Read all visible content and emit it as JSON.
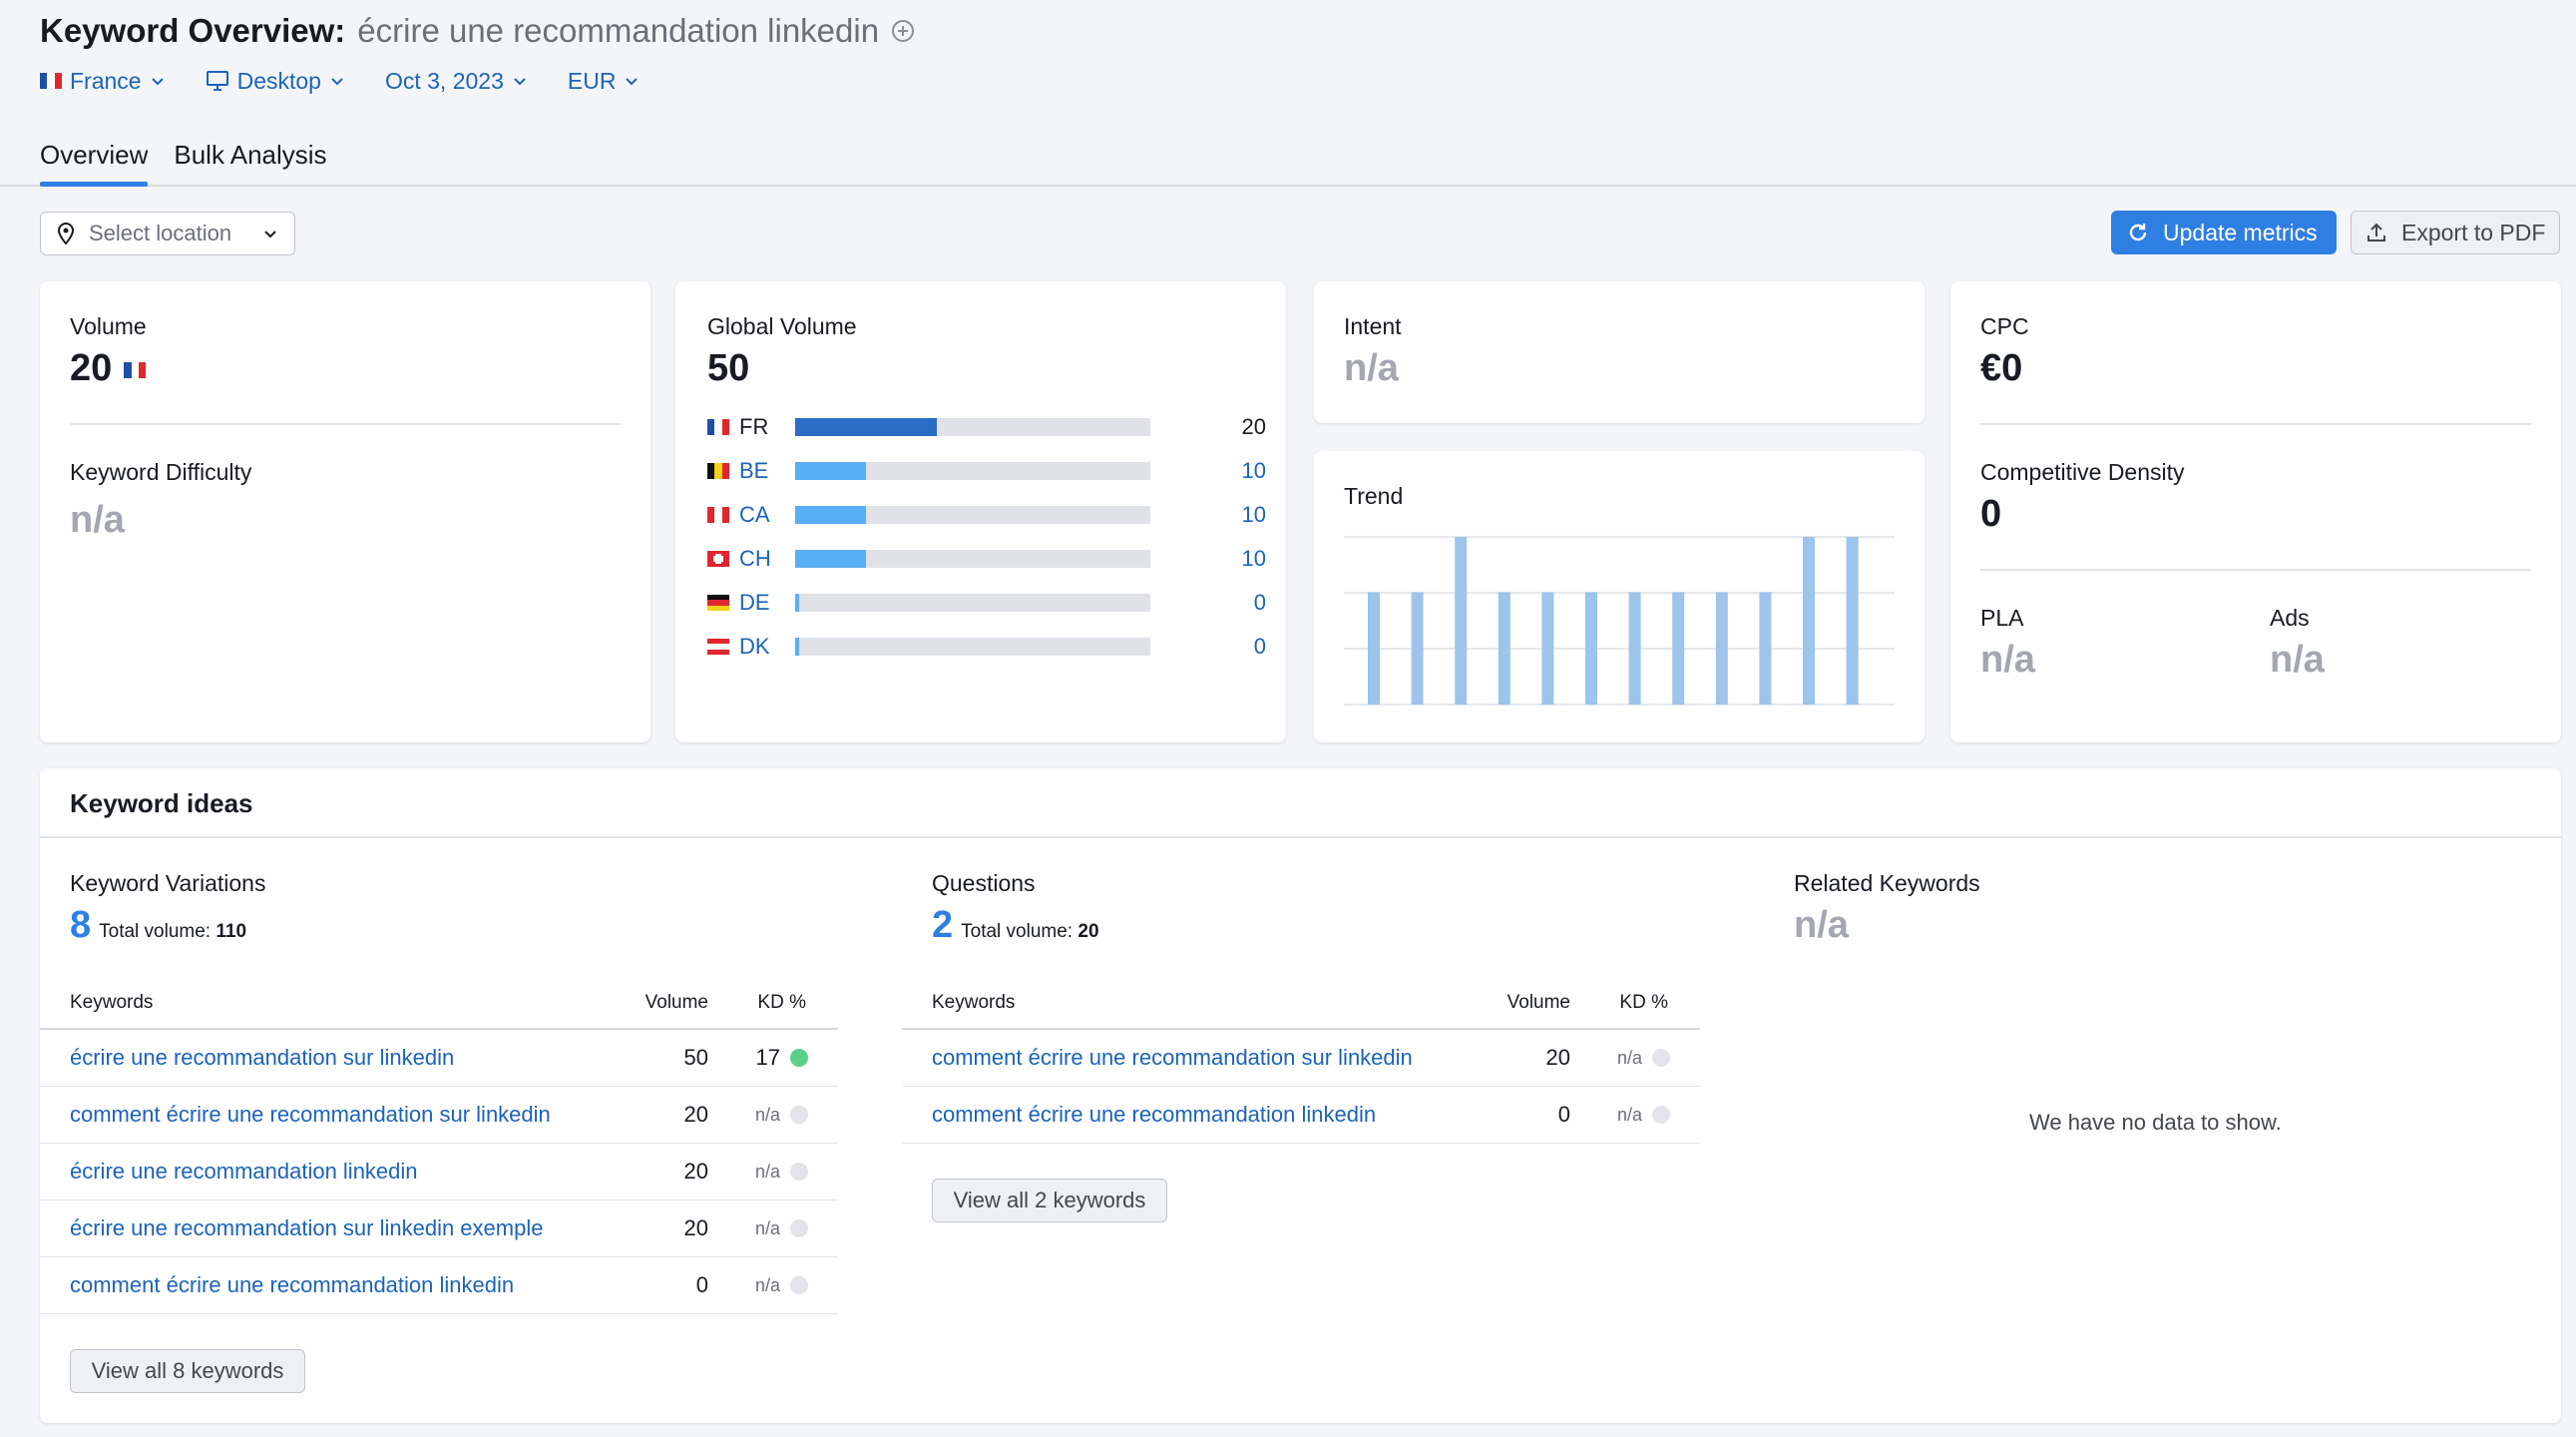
{
  "header": {
    "title": "Keyword Overview:",
    "keyword": "écrire une recommandation linkedin",
    "filters": {
      "country": "France",
      "device": "Desktop",
      "date": "Oct 3, 2023",
      "currency": "EUR"
    },
    "tabs": [
      "Overview",
      "Bulk Analysis"
    ]
  },
  "toolbar": {
    "location_placeholder": "Select location",
    "update_label": "Update metrics",
    "export_label": "Export to PDF"
  },
  "volume_card": {
    "volume_label": "Volume",
    "volume_value": "20",
    "kd_label": "Keyword Difficulty",
    "kd_value": "n/a"
  },
  "global_volume": {
    "label": "Global Volume",
    "value": "50",
    "max": 50,
    "countries": [
      {
        "code": "FR",
        "value": 20
      },
      {
        "code": "BE",
        "value": 10
      },
      {
        "code": "CA",
        "value": 10
      },
      {
        "code": "CH",
        "value": 10
      },
      {
        "code": "DE",
        "value": 0
      },
      {
        "code": "DK",
        "value": 0
      }
    ]
  },
  "intent": {
    "label": "Intent",
    "value": "n/a"
  },
  "trend": {
    "label": "Trend",
    "values": [
      0.67,
      0.67,
      1.0,
      0.67,
      0.67,
      0.67,
      0.67,
      0.67,
      0.67,
      0.67,
      1.0,
      1.0
    ]
  },
  "cpc_card": {
    "cpc_label": "CPC",
    "cpc_value": "€0",
    "cd_label": "Competitive Density",
    "cd_value": "0",
    "pla_label": "PLA",
    "pla_value": "n/a",
    "ads_label": "Ads",
    "ads_value": "n/a"
  },
  "keyword_ideas": {
    "title": "Keyword ideas",
    "variations": {
      "title": "Keyword Variations",
      "count": "8",
      "total_label": "Total volume:",
      "total_value": "110",
      "col_keywords": "Keywords",
      "col_volume": "Volume",
      "col_kd": "KD %",
      "rows": [
        {
          "keyword": "écrire une recommandation sur linkedin",
          "volume": "50",
          "kd": "17",
          "kd_color": "#5bd08a"
        },
        {
          "keyword": "comment écrire une recommandation sur linkedin",
          "volume": "20",
          "kd": "n/a",
          "kd_color": "#e2e4ea"
        },
        {
          "keyword": "écrire une recommandation linkedin",
          "volume": "20",
          "kd": "n/a",
          "kd_color": "#e2e4ea"
        },
        {
          "keyword": "écrire une recommandation sur linkedin exemple",
          "volume": "20",
          "kd": "n/a",
          "kd_color": "#e2e4ea"
        },
        {
          "keyword": "comment écrire une recommandation linkedin",
          "volume": "0",
          "kd": "n/a",
          "kd_color": "#e2e4ea"
        }
      ],
      "view_all": "View all 8 keywords"
    },
    "questions": {
      "title": "Questions",
      "count": "2",
      "total_label": "Total volume:",
      "total_value": "20",
      "col_keywords": "Keywords",
      "col_volume": "Volume",
      "col_kd": "KD %",
      "rows": [
        {
          "keyword": "comment écrire une recommandation sur linkedin",
          "volume": "20",
          "kd": "n/a",
          "kd_color": "#e2e4ea"
        },
        {
          "keyword": "comment écrire une recommandation linkedin",
          "volume": "0",
          "kd": "n/a",
          "kd_color": "#e2e4ea"
        }
      ],
      "view_all": "View all 2 keywords"
    },
    "related": {
      "title": "Related Keywords",
      "value": "n/a",
      "no_data": "We have no data to show."
    }
  },
  "colors": {
    "accent": "#2f7fe3",
    "link": "#1d63b8",
    "bar_primary": "#2b6cc4",
    "bar_secondary": "#5aaef5",
    "trend_bar": "#9dc4ea"
  }
}
